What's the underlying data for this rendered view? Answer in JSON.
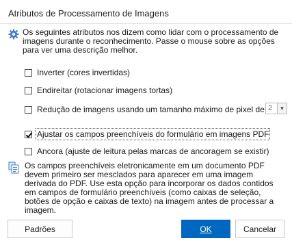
{
  "dialog": {
    "title": "Atributos de Processamento de Imagens",
    "intro_text": "Os seguintes atributos nos dizem como lidar com o processamento de imagens durante o reconhecimento. Passe o mouse sobre as opções para ver uma descrição melhor.",
    "intro_icon": "gear-icon",
    "options": [
      {
        "label": "Inverter (cores invertidas)",
        "checked": false
      },
      {
        "label": "Endireitar (rotacionar imagens tortas)",
        "checked": false
      },
      {
        "label": "Redução de imagens usando um tamanho máximo de pixel de",
        "checked": false
      },
      {
        "label": "Ajustar os campos preenchíveis do formulário em imagens PDF",
        "checked": true
      },
      {
        "label": "Ancora (ajuste de leitura pelas marcas de ancoragem se existir)",
        "checked": false
      }
    ],
    "pixel_size": {
      "value": "2",
      "arrow": "▼"
    },
    "info_icon": "info-panel-icon",
    "info_text": "Os campos preenchíveis eletronicamente em um documento PDF devem primeiro ser mesclados para aparecer em uma imagem derivada do PDF. Use esta opção para incorporar os dados contidos em campos de formulário preenchíveis (como caixas de seleção, botões de opção e caixas de texto) na imagem antes de processar a imagem.",
    "buttons": {
      "defaults": "Padrões",
      "ok": "OK",
      "cancel": "Cancelar"
    },
    "accent_color": "#0067c0"
  }
}
